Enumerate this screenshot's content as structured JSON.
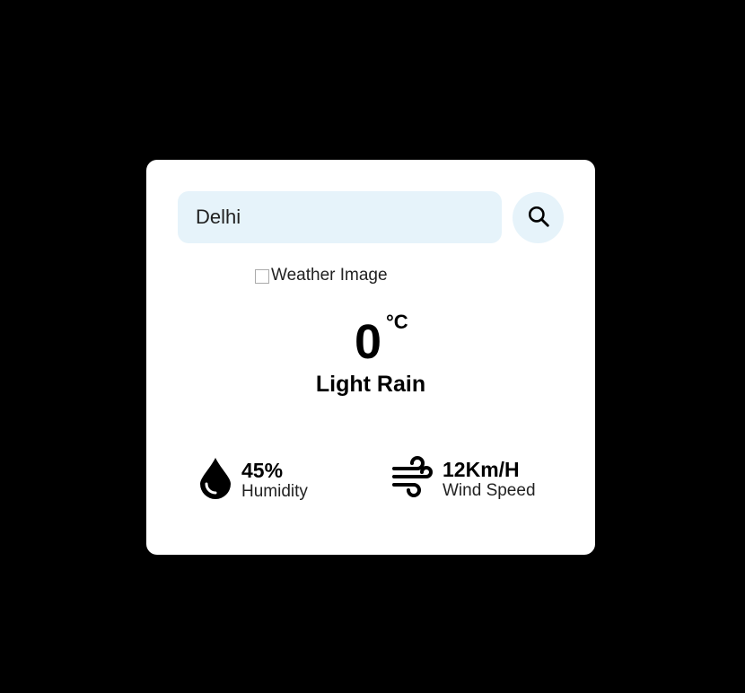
{
  "search": {
    "value": "Delhi"
  },
  "weather": {
    "image_alt": "Weather Image",
    "temperature": "0",
    "unit": "°C",
    "description": "Light Rain"
  },
  "stats": {
    "humidity": {
      "value": "45%",
      "label": "Humidity",
      "icon": "water-drop-icon"
    },
    "wind": {
      "value": "12Km/H",
      "label": "Wind Speed",
      "icon": "wind-icon"
    }
  },
  "icons": {
    "search": "search-icon"
  },
  "colors": {
    "background": "#000000",
    "card": "#ffffff",
    "input_bg": "#e6f3fa"
  }
}
